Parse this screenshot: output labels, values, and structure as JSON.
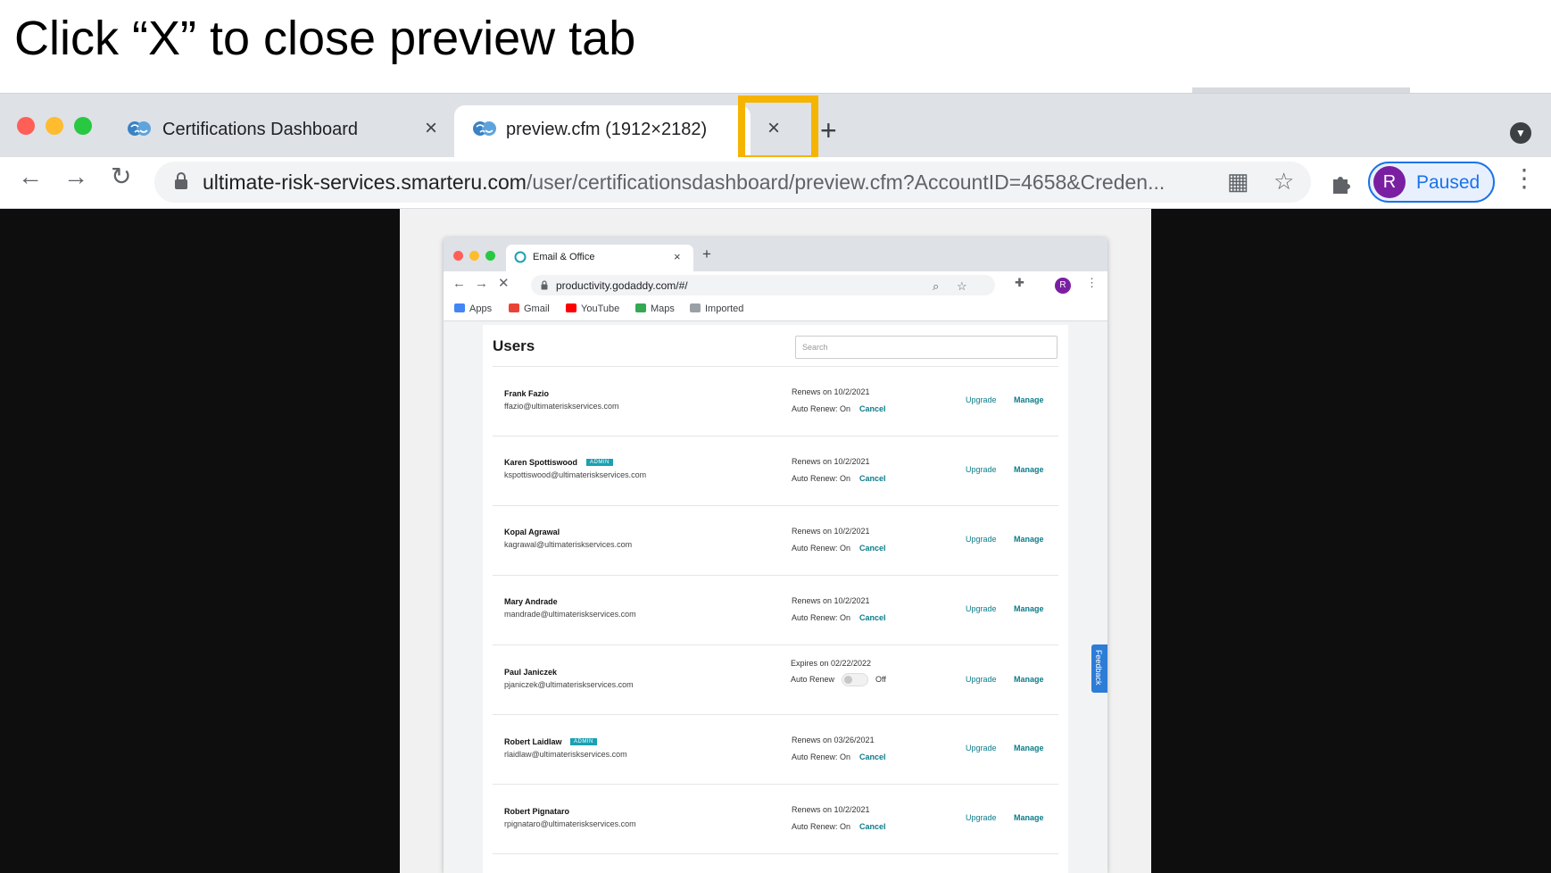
{
  "instruction": "Click “X” to close preview tab",
  "colors": {
    "highlight": "#f5b400",
    "accent": "#1a73e8",
    "teal_link": "#0b7c8a",
    "admin_badge": "#1ba1b3"
  },
  "browser": {
    "tabs": [
      {
        "title": "Certifications Dashboard",
        "icon": "brain-icon",
        "close_label": "×"
      },
      {
        "title": "preview.cfm (1912×2182)",
        "icon": "brain-icon",
        "close_label": "×",
        "active": true
      }
    ],
    "new_tab_label": "+",
    "url_host": "ultimate-risk-services.smarteru.com",
    "url_path": "/user/certificationsdashboard/preview.cfm?AccountID=4658&Creden...",
    "profile": {
      "initial": "R",
      "status": "Paused"
    }
  },
  "inner_browser": {
    "tab_title": "Email & Office",
    "close_label": "×",
    "new_tab_label": "+",
    "url": "productivity.godaddy.com/#/",
    "avatar_initial": "R",
    "bookmarks": [
      "Apps",
      "Gmail",
      "YouTube",
      "Maps",
      "Imported"
    ]
  },
  "page": {
    "title": "Users",
    "search_placeholder": "Search",
    "users": [
      {
        "name": "Frank Fazio",
        "email": "ffazio@ultimateriskservices.com",
        "admin": false,
        "renewal": "Renews on 10/2/2021",
        "auto_renew": "Auto Renew: On",
        "cancel": "Cancel",
        "upgrade": "Upgrade",
        "manage": "Manage"
      },
      {
        "name": "Karen Spottiswood",
        "email": "kspottiswood@ultimateriskservices.com",
        "admin": true,
        "badge": "ADMIN",
        "renewal": "Renews on 10/2/2021",
        "auto_renew": "Auto Renew: On",
        "cancel": "Cancel",
        "upgrade": "Upgrade",
        "manage": "Manage"
      },
      {
        "name": "Kopal Agrawal",
        "email": "kagrawal@ultimateriskservices.com",
        "admin": false,
        "renewal": "Renews on 10/2/2021",
        "auto_renew": "Auto Renew: On",
        "cancel": "Cancel",
        "upgrade": "Upgrade",
        "manage": "Manage"
      },
      {
        "name": "Mary Andrade",
        "email": "mandrade@ultimateriskservices.com",
        "admin": false,
        "renewal": "Renews on 10/2/2021",
        "auto_renew": "Auto Renew: On",
        "cancel": "Cancel",
        "upgrade": "Upgrade",
        "manage": "Manage"
      },
      {
        "name": "Paul Janiczek",
        "email": "pjaniczek@ultimateriskservices.com",
        "admin": false,
        "renewal": "Expires on 02/22/2022",
        "auto_renew": "Auto Renew",
        "toggle_state": "Off",
        "upgrade": "Upgrade",
        "manage": "Manage"
      },
      {
        "name": "Robert Laidlaw",
        "email": "rlaidlaw@ultimateriskservices.com",
        "admin": true,
        "badge": "ADMIN",
        "renewal": "Renews on 03/26/2021",
        "auto_renew": "Auto Renew: On",
        "cancel": "Cancel",
        "upgrade": "Upgrade",
        "manage": "Manage"
      },
      {
        "name": "Robert Pignataro",
        "email": "rpignataro@ultimateriskservices.com",
        "admin": false,
        "renewal": "Renews on 10/2/2021",
        "auto_renew": "Auto Renew: On",
        "cancel": "Cancel",
        "upgrade": "Upgrade",
        "manage": "Manage"
      }
    ],
    "feedback_label": "Feedback"
  }
}
